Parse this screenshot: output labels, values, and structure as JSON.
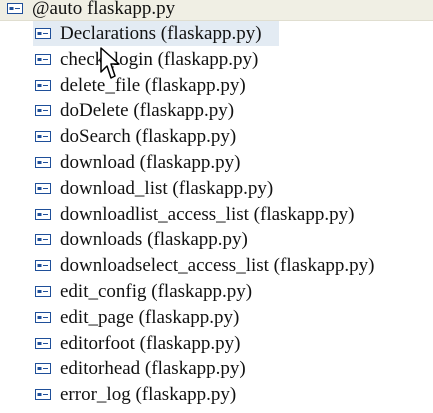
{
  "header": {
    "label": "@auto flaskapp.py",
    "icon": "member-icon"
  },
  "items": [
    {
      "label": "Declarations (flaskapp.py)",
      "icon": "member-icon"
    },
    {
      "label": "check_login (flaskapp.py)",
      "icon": "member-icon"
    },
    {
      "label": "delete_file (flaskapp.py)",
      "icon": "member-icon"
    },
    {
      "label": "doDelete (flaskapp.py)",
      "icon": "member-icon"
    },
    {
      "label": "doSearch (flaskapp.py)",
      "icon": "member-icon"
    },
    {
      "label": "download (flaskapp.py)",
      "icon": "member-icon"
    },
    {
      "label": "download_list (flaskapp.py)",
      "icon": "member-icon"
    },
    {
      "label": "downloadlist_access_list (flaskapp.py)",
      "icon": "member-icon"
    },
    {
      "label": "downloads (flaskapp.py)",
      "icon": "member-icon"
    },
    {
      "label": "downloadselect_access_list (flaskapp.py)",
      "icon": "member-icon"
    },
    {
      "label": "edit_config (flaskapp.py)",
      "icon": "member-icon"
    },
    {
      "label": "edit_page (flaskapp.py)",
      "icon": "member-icon"
    },
    {
      "label": "editorfoot (flaskapp.py)",
      "icon": "member-icon"
    },
    {
      "label": "editorhead (flaskapp.py)",
      "icon": "member-icon"
    },
    {
      "label": "error_log (flaskapp.py)",
      "icon": "member-icon"
    }
  ],
  "colors": {
    "icon_stroke": "#1f4f99",
    "selection": "#e3ebf3",
    "header_bg": "#f0efe4"
  }
}
